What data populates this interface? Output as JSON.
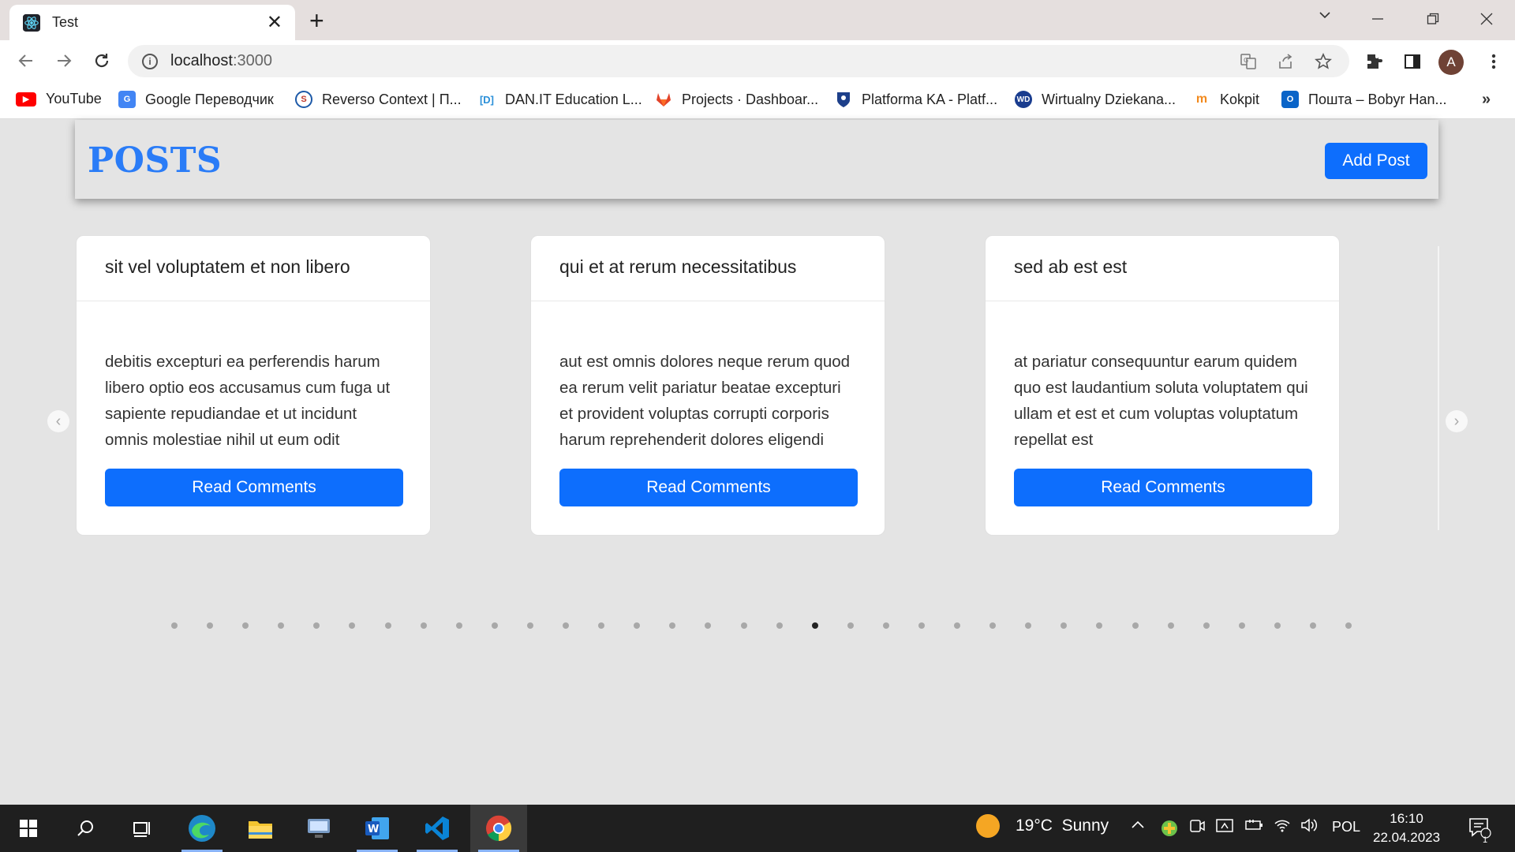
{
  "browser": {
    "tab_title": "Test",
    "url_host": "localhost",
    "url_port": ":3000",
    "avatar_letter": "A"
  },
  "bookmarks": [
    {
      "label": "YouTube",
      "icon": "youtube-icon",
      "color": "#ff0000"
    },
    {
      "label": "Google Переводчик",
      "icon": "google-translate-icon",
      "color": "#4285f4"
    },
    {
      "label": "Reverso Context | П...",
      "icon": "reverso-icon",
      "color": "#1e5aa8"
    },
    {
      "label": "DAN.IT Education L...",
      "icon": "danit-icon",
      "color": "#2a8fd8"
    },
    {
      "label": "Projects · Dashboar...",
      "icon": "gitlab-icon",
      "color": "#e24329"
    },
    {
      "label": "Platforma KA - Platf...",
      "icon": "platforma-icon",
      "color": "#1d3f8a"
    },
    {
      "label": "Wirtualny Dziekana...",
      "icon": "wd-icon",
      "color": "#1a3d8f"
    },
    {
      "label": "Kokpit",
      "icon": "kokpit-icon",
      "color": "#f28a1e"
    },
    {
      "label": "Пошта – Bobyr Han...",
      "icon": "outlook-icon",
      "color": "#0a64c8"
    }
  ],
  "header": {
    "title": "POSTS",
    "add_button": "Add Post"
  },
  "posts": [
    {
      "title": "sit vel voluptatem et non libero",
      "body": "debitis excepturi ea perferendis harum libero optio eos accusamus cum fuga ut sapiente repudiandae et ut incidunt omnis molestiae nihil ut eum odit",
      "button": "Read Comments"
    },
    {
      "title": "qui et at rerum necessitatibus",
      "body": "aut est omnis dolores neque rerum quod ea rerum velit pariatur beatae excepturi et provident voluptas corrupti corporis harum reprehenderit dolores eligendi",
      "button": "Read Comments"
    },
    {
      "title": "sed ab est est",
      "body": "at pariatur consequuntur earum quidem quo est laudantium soluta voluptatem qui ullam et est et cum voluptas voluptatum repellat est",
      "button": "Read Comments"
    }
  ],
  "carousel": {
    "dot_count": 34,
    "active_index": 18
  },
  "taskbar": {
    "weather": "19°C  Sunny",
    "language": "POL",
    "time": "16:10",
    "date": "22.04.2023",
    "notification_count": "1"
  },
  "colors": {
    "accent": "#0d6efd",
    "title": "#2a7cf7",
    "page_bg": "#e4e4e4"
  }
}
